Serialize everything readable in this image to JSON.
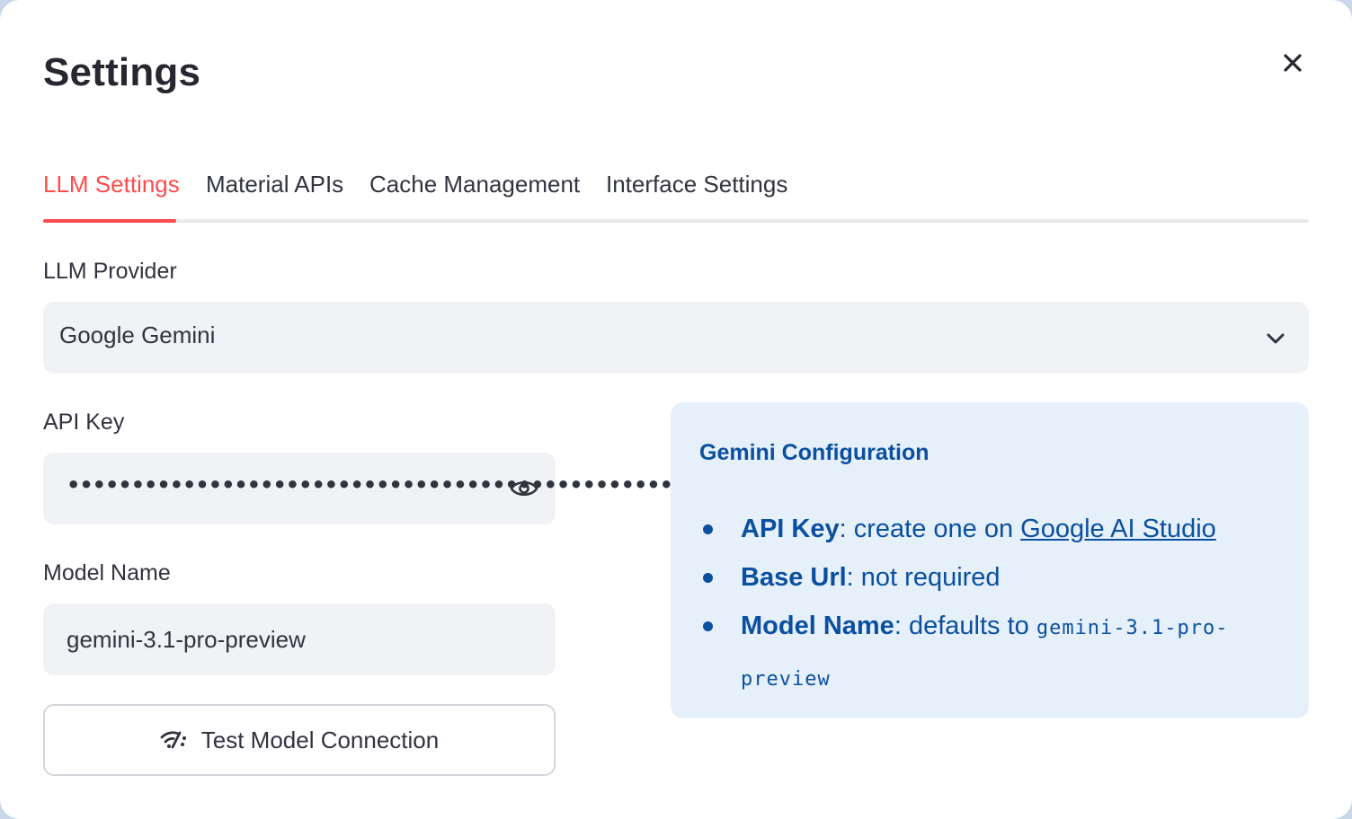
{
  "dialog": {
    "title": "Settings",
    "close_icon": "close-icon"
  },
  "tabs": [
    {
      "label": "LLM Settings",
      "active": true
    },
    {
      "label": "Material APIs",
      "active": false
    },
    {
      "label": "Cache Management",
      "active": false
    },
    {
      "label": "Interface Settings",
      "active": false
    }
  ],
  "provider": {
    "label": "LLM Provider",
    "selected": "Google Gemini",
    "icon": "chevron-down-icon"
  },
  "api_key": {
    "label": "API Key",
    "masked_value": "••••••••••••••••••••••••••••••••••••••••••••••••••••",
    "icon": "eye-icon"
  },
  "model": {
    "label": "Model Name",
    "value": "gemini-3.1-pro-preview"
  },
  "test_button": {
    "label": "Test Model Connection",
    "icon": "wifi-test-icon"
  },
  "info": {
    "heading": "Gemini Configuration",
    "items": [
      {
        "key": "API Key",
        "text": ": create one on ",
        "link": "Google AI Studio"
      },
      {
        "key": "Base Url",
        "text": ": not required"
      },
      {
        "key": "Model Name",
        "text": ": defaults to ",
        "code": "gemini-3.1-pro-preview"
      }
    ]
  },
  "colors": {
    "accent": "#ff4b4b",
    "info_bg": "#e6f0fb",
    "info_text": "#0b4fa0",
    "field_bg": "#f0f2f6"
  }
}
